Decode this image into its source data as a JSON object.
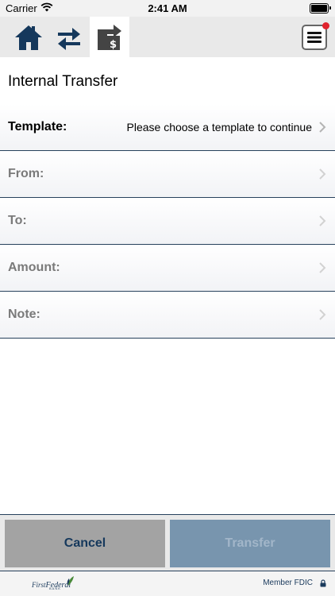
{
  "status_bar": {
    "carrier": "Carrier",
    "time": "2:41 AM"
  },
  "toolbar": {
    "icons": [
      "home-icon",
      "transfer-arrows-icon",
      "pay-bill-icon",
      "menu-icon"
    ],
    "active": "pay-bill-icon",
    "notification": true
  },
  "page": {
    "title": "Internal Transfer"
  },
  "form": {
    "template": {
      "label": "Template:",
      "value": "Please choose a template to continue"
    },
    "from": {
      "label": "From:",
      "value": ""
    },
    "to": {
      "label": "To:",
      "value": ""
    },
    "amount": {
      "label": "Amount:",
      "value": ""
    },
    "note": {
      "label": "Note:",
      "value": ""
    }
  },
  "actions": {
    "cancel_label": "Cancel",
    "transfer_label": "Transfer"
  },
  "footer": {
    "logo_first": "First",
    "logo_federal": "Federal",
    "logo_bank": "BANK",
    "member_fdic": "Member FDIC"
  },
  "colors": {
    "navy": "#15385c",
    "divider": "#27415c",
    "cancel_bg": "#a3a3a3",
    "transfer_bg": "#7895ae",
    "notification": "#e0232d"
  }
}
